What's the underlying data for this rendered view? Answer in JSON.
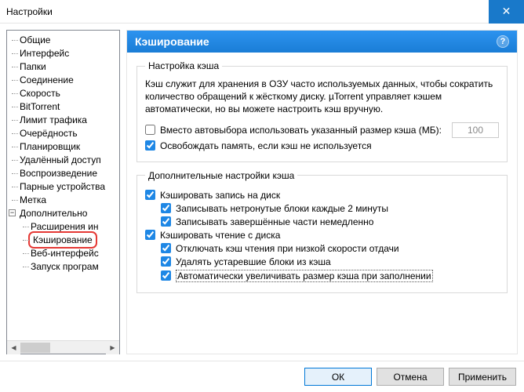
{
  "window": {
    "title": "Настройки"
  },
  "tree": {
    "items": [
      "Общие",
      "Интерфейс",
      "Папки",
      "Соединение",
      "Скорость",
      "BitTorrent",
      "Лимит трафика",
      "Очерёдность",
      "Планировщик",
      "Удалённый доступ",
      "Воспроизведение",
      "Парные устройства",
      "Метка"
    ],
    "parent": "Дополнительно",
    "subitems": [
      "Расширения ин",
      "Кэширование",
      "Веб-интерфейс",
      "Запуск програм"
    ]
  },
  "header": {
    "title": "Кэширование"
  },
  "section1": {
    "legend": "Настройка кэша",
    "desc": "Кэш служит для хранения в ОЗУ часто используемых данных, чтобы сократить количество обращений к жёсткому диску. µTorrent управляет кэшем автоматически, но вы можете настроить кэш вручную.",
    "cb1": "Вместо автовыбора использовать указанный размер кэша (МБ):",
    "size": "100",
    "cb2": "Освобождать память, если кэш не используется"
  },
  "section2": {
    "legend": "Дополнительные настройки кэша",
    "cb_write": "Кэшировать запись на диск",
    "cb_w1": "Записывать нетронутые блоки каждые 2 минуты",
    "cb_w2": "Записывать завершённые части немедленно",
    "cb_read": "Кэшировать чтение с диска",
    "cb_r1": "Отключать кэш чтения при низкой скорости отдачи",
    "cb_r2": "Удалять устаревшие блоки из кэша",
    "cb_r3": "Автоматически увеличивать размер кэша при заполнении"
  },
  "buttons": {
    "ok": "ОК",
    "cancel": "Отмена",
    "apply": "Применить"
  }
}
